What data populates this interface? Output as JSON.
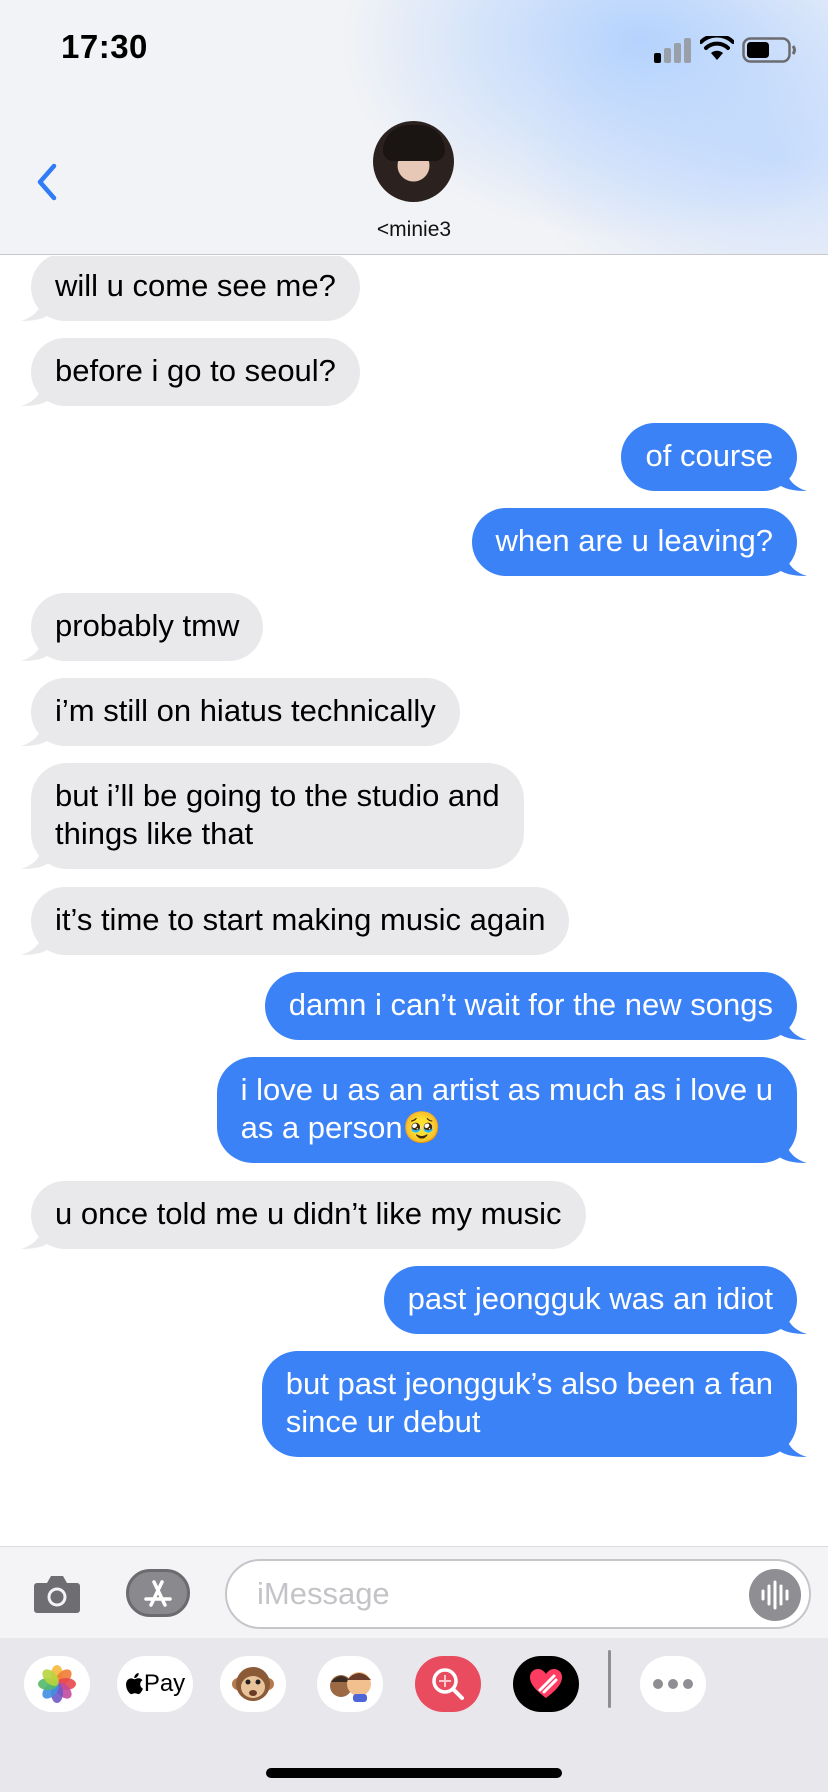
{
  "status_bar": {
    "time": "17:30"
  },
  "header": {
    "contact_name": "<minie3"
  },
  "messages": [
    {
      "dir": "in",
      "lines": [
        "will u come see me?"
      ]
    },
    {
      "dir": "in",
      "lines": [
        "before i go to seoul?"
      ]
    },
    {
      "dir": "out",
      "lines": [
        "of course"
      ]
    },
    {
      "dir": "out",
      "lines": [
        "when are u leaving?"
      ]
    },
    {
      "dir": "in",
      "lines": [
        "probably tmw"
      ]
    },
    {
      "dir": "in",
      "lines": [
        "i’m still on hiatus technically"
      ]
    },
    {
      "dir": "in",
      "lines": [
        "but i’ll be going to the studio and",
        "things like that"
      ]
    },
    {
      "dir": "in",
      "lines": [
        "it’s time to start making music again"
      ]
    },
    {
      "dir": "out",
      "lines": [
        "damn i can’t wait for the new songs"
      ]
    },
    {
      "dir": "out",
      "lines": [
        "i love u as an artist as much as i love u",
        "as a person🥹"
      ]
    },
    {
      "dir": "in",
      "lines": [
        "u once told me u didn’t like my music"
      ]
    },
    {
      "dir": "out",
      "lines": [
        "past jeongguk was an idiot"
      ]
    },
    {
      "dir": "out",
      "lines": [
        "but past jeongguk’s also been a fan",
        "since ur debut"
      ]
    }
  ],
  "composer": {
    "placeholder": "iMessage"
  },
  "app_drawer": {
    "apple_pay_label": "Pay",
    "apps": [
      "photos-icon",
      "apple-pay-icon",
      "monkey-memoji-icon",
      "memoji-icon",
      "search-images-icon",
      "digital-touch-icon",
      "more-apps-icon"
    ]
  },
  "colors": {
    "outgoing": "#3a82f6",
    "incoming": "#e9e9eb",
    "accent": "#2f7cf6"
  }
}
